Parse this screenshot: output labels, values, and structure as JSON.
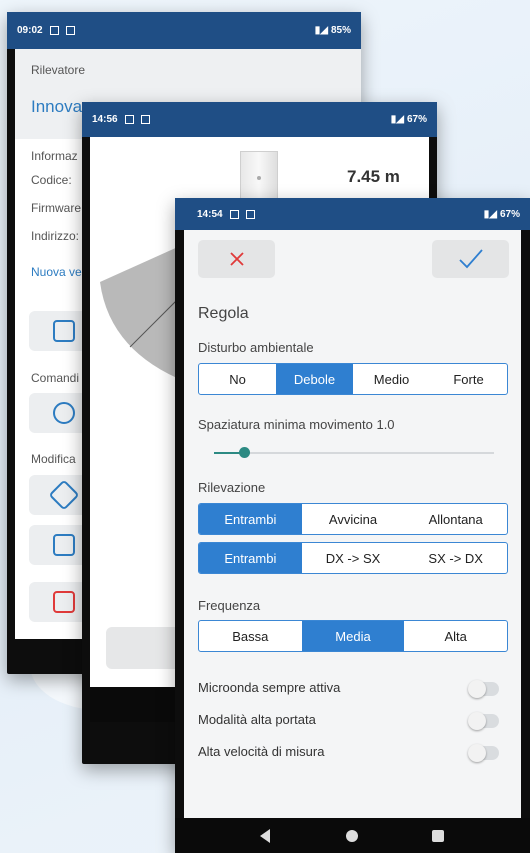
{
  "phoneA": {
    "status": {
      "time": "09:02",
      "battery": "85%"
    },
    "label_rilevatore": "Rilevatore",
    "title": "Innova",
    "info_label": "Informaz",
    "codice_label": "Codice:",
    "firmware_label": "Firmware",
    "indirizzo_label": "Indirizzo:",
    "new_version_link": "Nuova ve",
    "comandi_label": "Comandi",
    "modifica_label": "Modifica"
  },
  "phoneB": {
    "status": {
      "time": "14:56",
      "battery": "67%"
    },
    "distance": "7.45 m"
  },
  "phoneC": {
    "status": {
      "time": "14:54",
      "battery": "67%"
    },
    "title": "Regola",
    "disturbo": {
      "label": "Disturbo ambientale",
      "options": [
        "No",
        "Debole",
        "Medio",
        "Forte"
      ],
      "selected": "Debole"
    },
    "spaziatura": {
      "label": "Spaziatura minima movimento 1.0",
      "value": 0.1
    },
    "rilevazione": {
      "label": "Rilevazione",
      "direction_options": [
        "Entrambi",
        "Avvicina",
        "Allontana"
      ],
      "direction_selected": "Entrambi",
      "side_options": [
        "Entrambi",
        "DX -> SX",
        "SX -> DX"
      ],
      "side_selected": "Entrambi"
    },
    "frequenza": {
      "label": "Frequenza",
      "options": [
        "Bassa",
        "Media",
        "Alta"
      ],
      "selected": "Media"
    },
    "toggles": [
      {
        "label": "Microonda sempre attiva",
        "on": false
      },
      {
        "label": "Modalità alta portata",
        "on": false
      },
      {
        "label": "Alta velocità di misura",
        "on": false
      }
    ]
  },
  "colors": {
    "status_bar": "#1f4e85",
    "accent": "#2f7fd0",
    "cancel": "#e03a3a",
    "slider": "#2c8a83"
  }
}
